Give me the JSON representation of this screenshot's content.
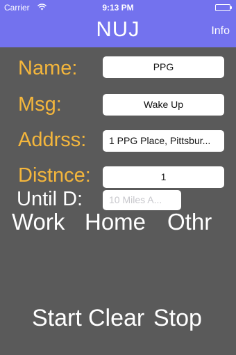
{
  "status": {
    "carrier": "Carrier",
    "time": "9:13 PM"
  },
  "nav": {
    "title": "NUJ",
    "info_label": "Info"
  },
  "form": {
    "name": {
      "label": "Name:",
      "value": "PPG"
    },
    "msg": {
      "label": "Msg:",
      "value": "Wake Up"
    },
    "address": {
      "label": "Addrss:",
      "value": "1 PPG Place, Pittsbur..."
    },
    "distance": {
      "label": "Distnce:",
      "value": "1"
    },
    "until": {
      "label": "Until D:",
      "placeholder": "10 Miles A..."
    }
  },
  "destinations": {
    "work": "Work",
    "home": "Home",
    "other": "Othr"
  },
  "actions": {
    "start": "Start",
    "clear": "Clear",
    "stop": "Stop"
  },
  "colors": {
    "bar": "#7372ee",
    "background": "#5a5a5a",
    "label": "#f4b63c",
    "text": "#ffffff"
  }
}
